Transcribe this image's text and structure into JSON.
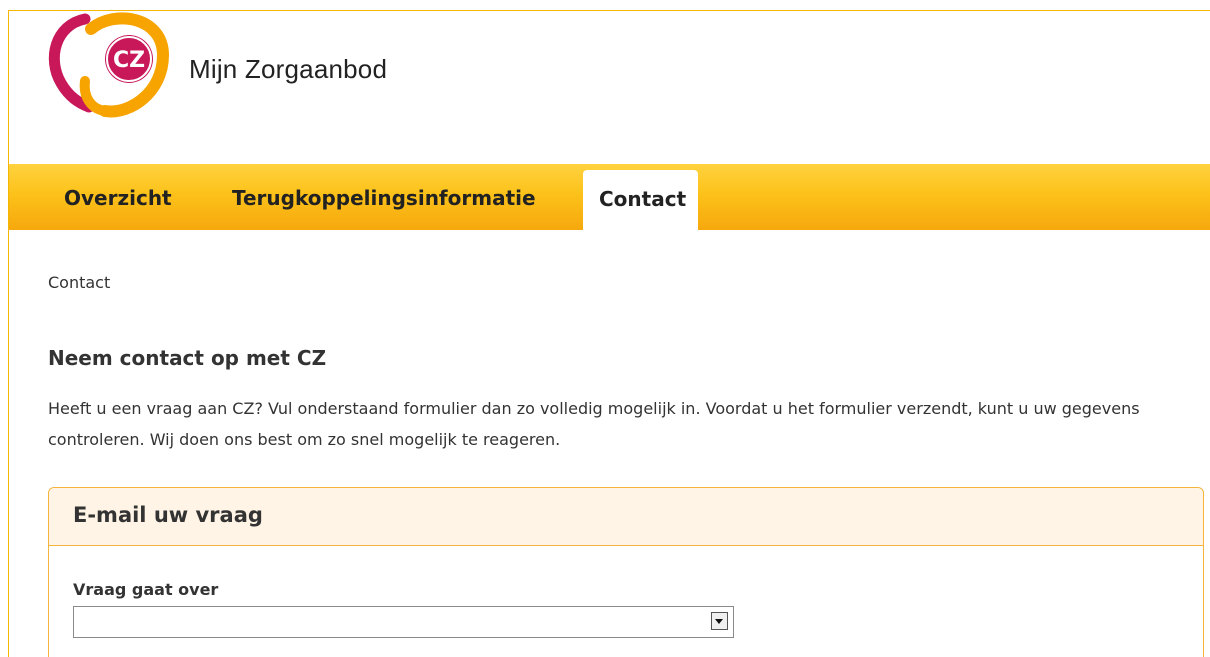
{
  "header": {
    "logo_text": "CZ",
    "site_title": "Mijn Zorgaanbod"
  },
  "nav": {
    "items": [
      {
        "label": "Overzicht",
        "active": false
      },
      {
        "label": "Terugkoppelingsinformatie",
        "active": false
      },
      {
        "label": "Contact",
        "active": true
      }
    ]
  },
  "breadcrumb": "Contact",
  "main": {
    "heading": "Neem contact op met CZ",
    "intro": "Heeft u een vraag aan CZ? Vul onderstaand formulier dan zo volledig mogelijk in. Voordat u het formulier verzendt, kunt u uw gegevens controleren. Wij doen ons best om zo snel mogelijk te reageren."
  },
  "form": {
    "panel_title": "E-mail uw vraag",
    "subject_label": "Vraag gaat over",
    "subject_value": ""
  },
  "colors": {
    "brand_yellow": "#fcc21a",
    "brand_magenta": "#d4145a",
    "panel_header_bg": "#fff4e5",
    "panel_border": "#f5b53c"
  }
}
